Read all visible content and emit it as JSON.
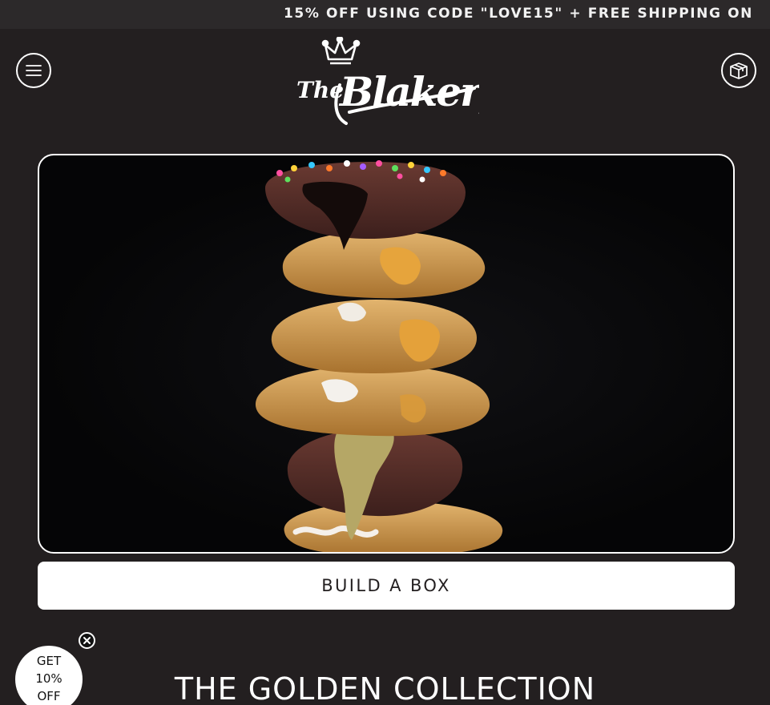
{
  "announcement": {
    "text": "15% OFF USING CODE \"LOVE15\" + FREE SHIPPING ON"
  },
  "header": {
    "menu_icon": "hamburger-menu-icon",
    "cart_icon": "box-icon",
    "logo_text": "The Blakery"
  },
  "hero": {
    "image_description_icon": "cookie-stack-image"
  },
  "build_box": {
    "label": "BUILD A BOX"
  },
  "collection": {
    "title": "THE GOLDEN COLLECTION"
  },
  "promo": {
    "line1": "GET",
    "line2": "10%",
    "line3": "OFF",
    "close_icon": "close-icon"
  },
  "colors": {
    "background": "#231f20",
    "announcement_bg": "#2c292a",
    "button_bg": "#ffffff",
    "text_dark": "#231f20"
  }
}
